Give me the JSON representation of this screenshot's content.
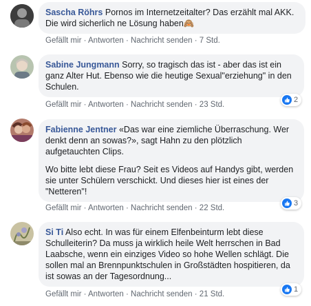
{
  "colors": {
    "author": "#385898",
    "bubble": "#f2f3f5",
    "like": "#1877f2",
    "meta": "#606770"
  },
  "actions": {
    "like": "Gefällt mir",
    "reply": "Antworten",
    "message": "Nachricht senden",
    "dot": "·"
  },
  "comments": [
    {
      "author": "Sascha Röhrs",
      "paragraphs": [
        "Pornos im Internetzeitalter? Das erzählt mal AKK. Die wird sicherlich ne Lösung haben🙈"
      ],
      "time": "7 Std.",
      "reactions": null
    },
    {
      "author": "Sabine Jungmann",
      "paragraphs": [
        "Sorry, so tragisch das ist - aber das ist ein ganz Alter Hut. Ebenso wie die heutige Sexual\"erziehung\" in den Schulen."
      ],
      "time": "23 Std.",
      "reactions": "2"
    },
    {
      "author": "Fabienne Jentner",
      "paragraphs": [
        "«Das war eine ziemliche Überraschung. Wer denkt denn an sowas?», sagt Hahn zu den plötzlich aufgetauchten Clips.",
        "Wo bitte lebt diese Frau? Seit es Videos auf Handys gibt, werden sie unter Schülern verschickt. Und dieses hier ist eines der \"Netteren\"!"
      ],
      "time": "22 Std.",
      "reactions": "3"
    },
    {
      "author": "Si Ti",
      "paragraphs": [
        "Also echt. In was für einem Elfenbeinturm lebt diese Schulleiterin? Da muss ja wirklich heile Welt herrschen in Bad Laabsche, wenn ein einziges Video so hohe Wellen schlägt. Die sollen mal an Brennpunktschulen in Großstädten hospitieren, da ist sowas an der Tagesordnung..."
      ],
      "time": "21 Std.",
      "reactions": "1"
    }
  ]
}
